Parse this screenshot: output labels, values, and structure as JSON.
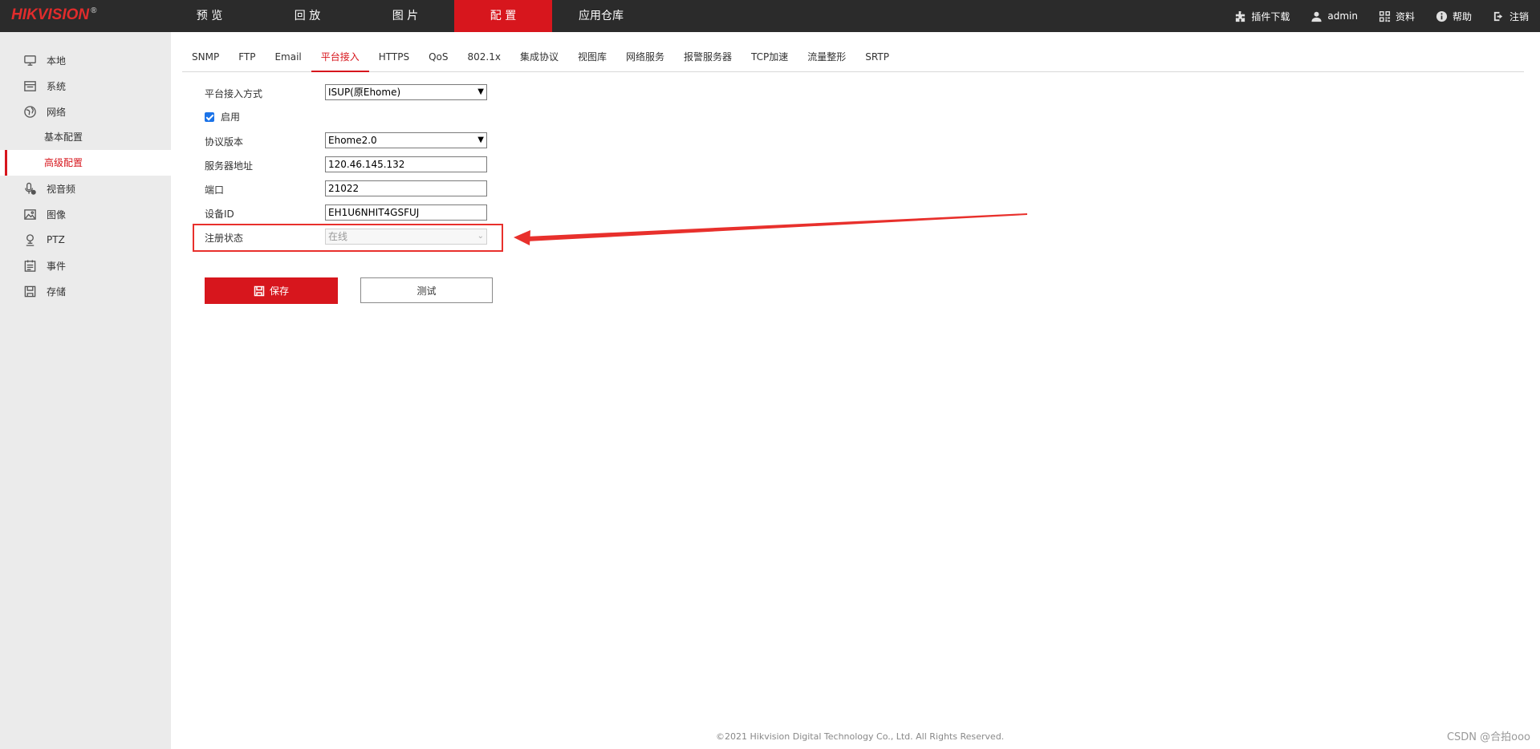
{
  "logo": {
    "text": "HIKVISION",
    "mark": "®"
  },
  "top_nav": [
    {
      "label": "预 览",
      "active": false
    },
    {
      "label": "回 放",
      "active": false
    },
    {
      "label": "图 片",
      "active": false
    },
    {
      "label": "配 置",
      "active": true
    },
    {
      "label": "应用仓库",
      "active": false
    }
  ],
  "toolbar": {
    "plugin": {
      "label": "插件下载",
      "icon": "puzzle-icon"
    },
    "user": {
      "label": "admin",
      "icon": "user-icon"
    },
    "data": {
      "label": "资料",
      "icon": "qrcode-icon"
    },
    "help": {
      "label": "帮助",
      "icon": "help-icon"
    },
    "logout": {
      "label": "注销",
      "icon": "logout-icon"
    }
  },
  "sidebar": {
    "items": [
      {
        "label": "本地",
        "icon": "monitor-icon"
      },
      {
        "label": "系统",
        "icon": "system-icon"
      },
      {
        "label": "网络",
        "icon": "globe-icon"
      },
      {
        "label": "视音频",
        "icon": "microphone-icon"
      },
      {
        "label": "图像",
        "icon": "image-icon"
      },
      {
        "label": "PTZ",
        "icon": "ptz-icon"
      },
      {
        "label": "事件",
        "icon": "calendar-icon"
      },
      {
        "label": "存储",
        "icon": "storage-icon"
      }
    ],
    "network_sub": [
      {
        "label": "基本配置",
        "active": false
      },
      {
        "label": "高级配置",
        "active": true
      }
    ]
  },
  "tabs": [
    {
      "label": "SNMP"
    },
    {
      "label": "FTP"
    },
    {
      "label": "Email"
    },
    {
      "label": "平台接入",
      "active": true
    },
    {
      "label": "HTTPS"
    },
    {
      "label": "QoS"
    },
    {
      "label": "802.1x"
    },
    {
      "label": "集成协议"
    },
    {
      "label": "视图库"
    },
    {
      "label": "网络服务"
    },
    {
      "label": "报警服务器"
    },
    {
      "label": "TCP加速"
    },
    {
      "label": "流量整形"
    },
    {
      "label": "SRTP"
    }
  ],
  "form": {
    "access_mode": {
      "label": "平台接入方式",
      "value": "ISUP(原Ehome)"
    },
    "enable": {
      "label": "启用",
      "checked": true
    },
    "protocol_version": {
      "label": "协议版本",
      "value": "Ehome2.0"
    },
    "server_address": {
      "label": "服务器地址",
      "value": "120.46.145.132"
    },
    "port": {
      "label": "端口",
      "value": "21022"
    },
    "device_id": {
      "label": "设备ID",
      "value": "EH1U6NHIT4GSFUJ"
    },
    "register_status": {
      "label": "注册状态",
      "value": "在线"
    }
  },
  "buttons": {
    "save": "保存",
    "test": "测试"
  },
  "footer": "©2021 Hikvision Digital Technology Co., Ltd. All Rights Reserved.",
  "watermark": "CSDN @合拍ooo",
  "colors": {
    "accent": "#d7161d",
    "topbar": "#2b2b2b",
    "sidebar": "#ebebeb",
    "annotation": "#e8302c"
  }
}
